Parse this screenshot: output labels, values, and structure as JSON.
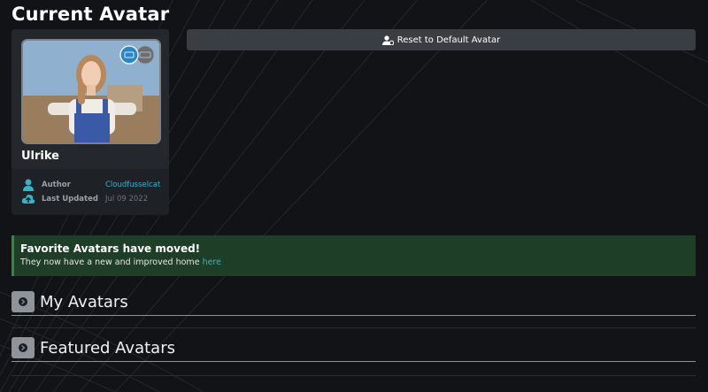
{
  "page": {
    "title": "Current Avatar"
  },
  "current_avatar": {
    "name": "Ulrike",
    "platform_badges": [
      "pc-icon",
      "quest-icon"
    ],
    "meta": {
      "author_label": "Author",
      "author_value": "Cloudfusselcat",
      "updated_label": "Last Updated",
      "updated_value": "Jul 09 2022"
    }
  },
  "actions": {
    "reset_label": "Reset to Default Avatar"
  },
  "notice": {
    "title": "Favorite Avatars have moved!",
    "body": "They now have a new and improved home ",
    "link_text": "here"
  },
  "sections": [
    {
      "title": "My Avatars"
    },
    {
      "title": "Featured Avatars"
    }
  ],
  "colors": {
    "background": "#121317",
    "accent": "#37b3c7",
    "notice_bg": "#1f3e27",
    "notice_border": "#2f8b3e"
  }
}
